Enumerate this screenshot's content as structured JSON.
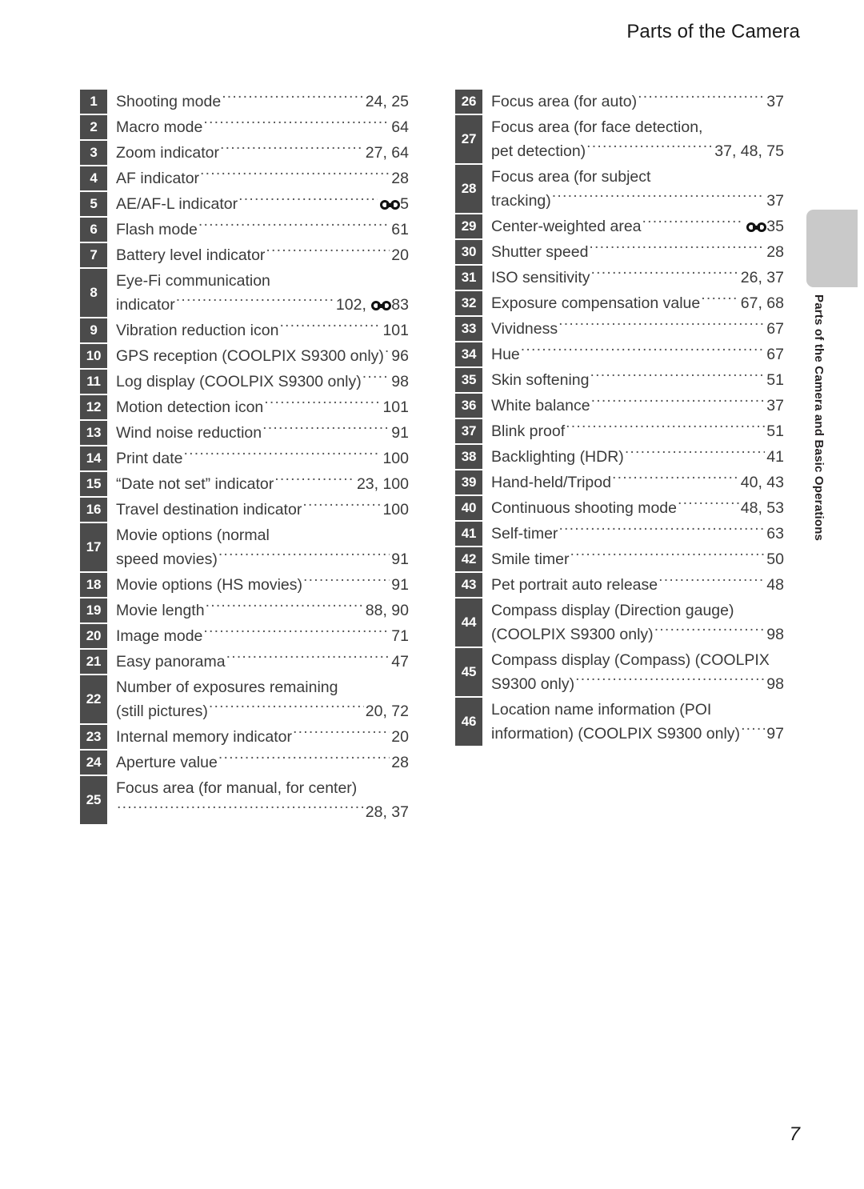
{
  "header": {
    "title": "Parts of the Camera"
  },
  "side_tab": {
    "label": "Parts of the Camera and Basic Operations",
    "color": "#c9c9c9"
  },
  "footer": {
    "page_number": "7"
  },
  "styles": {
    "number_box_color": "#4b4b4b",
    "text_color": "#3a3a3a"
  },
  "icons": {
    "reference_manual": "binoculars-reference-icon"
  },
  "legend": {
    "left_column": [
      {
        "num": "1",
        "lines": 1,
        "label": "Shooting mode",
        "page": "24, 25"
      },
      {
        "num": "2",
        "lines": 1,
        "label": "Macro mode",
        "page": "64"
      },
      {
        "num": "3",
        "lines": 1,
        "label": "Zoom indicator",
        "page": "27, 64"
      },
      {
        "num": "4",
        "lines": 1,
        "label": "AF indicator",
        "page": "28"
      },
      {
        "num": "5",
        "lines": 1,
        "label": "AE/AF-L indicator",
        "page": "5",
        "page_icon": true
      },
      {
        "num": "6",
        "lines": 1,
        "label": "Flash mode",
        "page": "61"
      },
      {
        "num": "7",
        "lines": 1,
        "label": "Battery level indicator",
        "page": "20"
      },
      {
        "num": "8",
        "lines": 2,
        "label_line1": "Eye-Fi communication",
        "label": "indicator",
        "page_prefix": "102, ",
        "page": "83",
        "page_icon": true
      },
      {
        "num": "9",
        "lines": 1,
        "label": "Vibration reduction icon",
        "page": "101"
      },
      {
        "num": "10",
        "lines": 1,
        "label": "GPS reception (COOLPIX S9300 only)",
        "page": "96"
      },
      {
        "num": "11",
        "lines": 1,
        "label": "Log display (COOLPIX S9300 only)",
        "page": "98"
      },
      {
        "num": "12",
        "lines": 1,
        "label": "Motion detection icon",
        "page": "101"
      },
      {
        "num": "13",
        "lines": 1,
        "label": "Wind noise reduction",
        "page": "91"
      },
      {
        "num": "14",
        "lines": 1,
        "label": "Print date",
        "page": "100"
      },
      {
        "num": "15",
        "lines": 1,
        "label": "“Date not set” indicator",
        "page": "23, 100"
      },
      {
        "num": "16",
        "lines": 1,
        "label": "Travel destination indicator",
        "page": "100"
      },
      {
        "num": "17",
        "lines": 2,
        "label_line1": "Movie options (normal",
        "label": "speed movies)",
        "page": "91"
      },
      {
        "num": "18",
        "lines": 1,
        "label": "Movie options (HS movies)",
        "page": "91"
      },
      {
        "num": "19",
        "lines": 1,
        "label": "Movie length",
        "page": "88, 90"
      },
      {
        "num": "20",
        "lines": 1,
        "label": "Image mode",
        "page": "71"
      },
      {
        "num": "21",
        "lines": 1,
        "label": "Easy panorama",
        "page": "47"
      },
      {
        "num": "22",
        "lines": 2,
        "label_line1": "Number of exposures remaining",
        "label": "(still pictures)",
        "page": "20, 72"
      },
      {
        "num": "23",
        "lines": 1,
        "label": "Internal memory indicator",
        "page": "20"
      },
      {
        "num": "24",
        "lines": 1,
        "label": "Aperture value",
        "page": "28"
      },
      {
        "num": "25",
        "lines": 2,
        "label_line1": "Focus area (for manual, for center)",
        "label": "",
        "page": "28, 37"
      }
    ],
    "right_column": [
      {
        "num": "26",
        "lines": 1,
        "label": "Focus area (for auto)",
        "page": "37"
      },
      {
        "num": "27",
        "lines": 2,
        "label_line1": "Focus area (for face detection,",
        "label": "pet detection)",
        "page": "37, 48, 75"
      },
      {
        "num": "28",
        "lines": 2,
        "label_line1": "Focus area (for subject",
        "label": "tracking)",
        "page": "37"
      },
      {
        "num": "29",
        "lines": 1,
        "label": "Center-weighted area",
        "page": "35",
        "page_icon": true
      },
      {
        "num": "30",
        "lines": 1,
        "label": "Shutter speed",
        "page": "28"
      },
      {
        "num": "31",
        "lines": 1,
        "label": "ISO sensitivity",
        "page": "26, 37"
      },
      {
        "num": "32",
        "lines": 1,
        "label": "Exposure compensation value",
        "page": "67, 68"
      },
      {
        "num": "33",
        "lines": 1,
        "label": "Vividness",
        "page": "67"
      },
      {
        "num": "34",
        "lines": 1,
        "label": "Hue",
        "page": "67"
      },
      {
        "num": "35",
        "lines": 1,
        "label": "Skin softening",
        "page": "51"
      },
      {
        "num": "36",
        "lines": 1,
        "label": "White balance",
        "page": "37"
      },
      {
        "num": "37",
        "lines": 1,
        "label": "Blink proof",
        "page": "51"
      },
      {
        "num": "38",
        "lines": 1,
        "label": "Backlighting (HDR)",
        "page": "41"
      },
      {
        "num": "39",
        "lines": 1,
        "label": "Hand-held/Tripod",
        "page": "40, 43"
      },
      {
        "num": "40",
        "lines": 1,
        "label": "Continuous shooting mode",
        "page": "48, 53"
      },
      {
        "num": "41",
        "lines": 1,
        "label": "Self-timer",
        "page": "63"
      },
      {
        "num": "42",
        "lines": 1,
        "label": "Smile timer",
        "page": "50"
      },
      {
        "num": "43",
        "lines": 1,
        "label": "Pet portrait auto release",
        "page": "48"
      },
      {
        "num": "44",
        "lines": 2,
        "label_line1": "Compass display (Direction gauge)",
        "label": "(COOLPIX S9300 only)",
        "page": "98"
      },
      {
        "num": "45",
        "lines": 2,
        "label_line1": "Compass display (Compass) (COOLPIX",
        "label": "S9300 only)",
        "page": "98"
      },
      {
        "num": "46",
        "lines": 2,
        "label_line1": "Location name information (POI",
        "label": "information) (COOLPIX S9300 only)",
        "page": "97"
      }
    ]
  }
}
